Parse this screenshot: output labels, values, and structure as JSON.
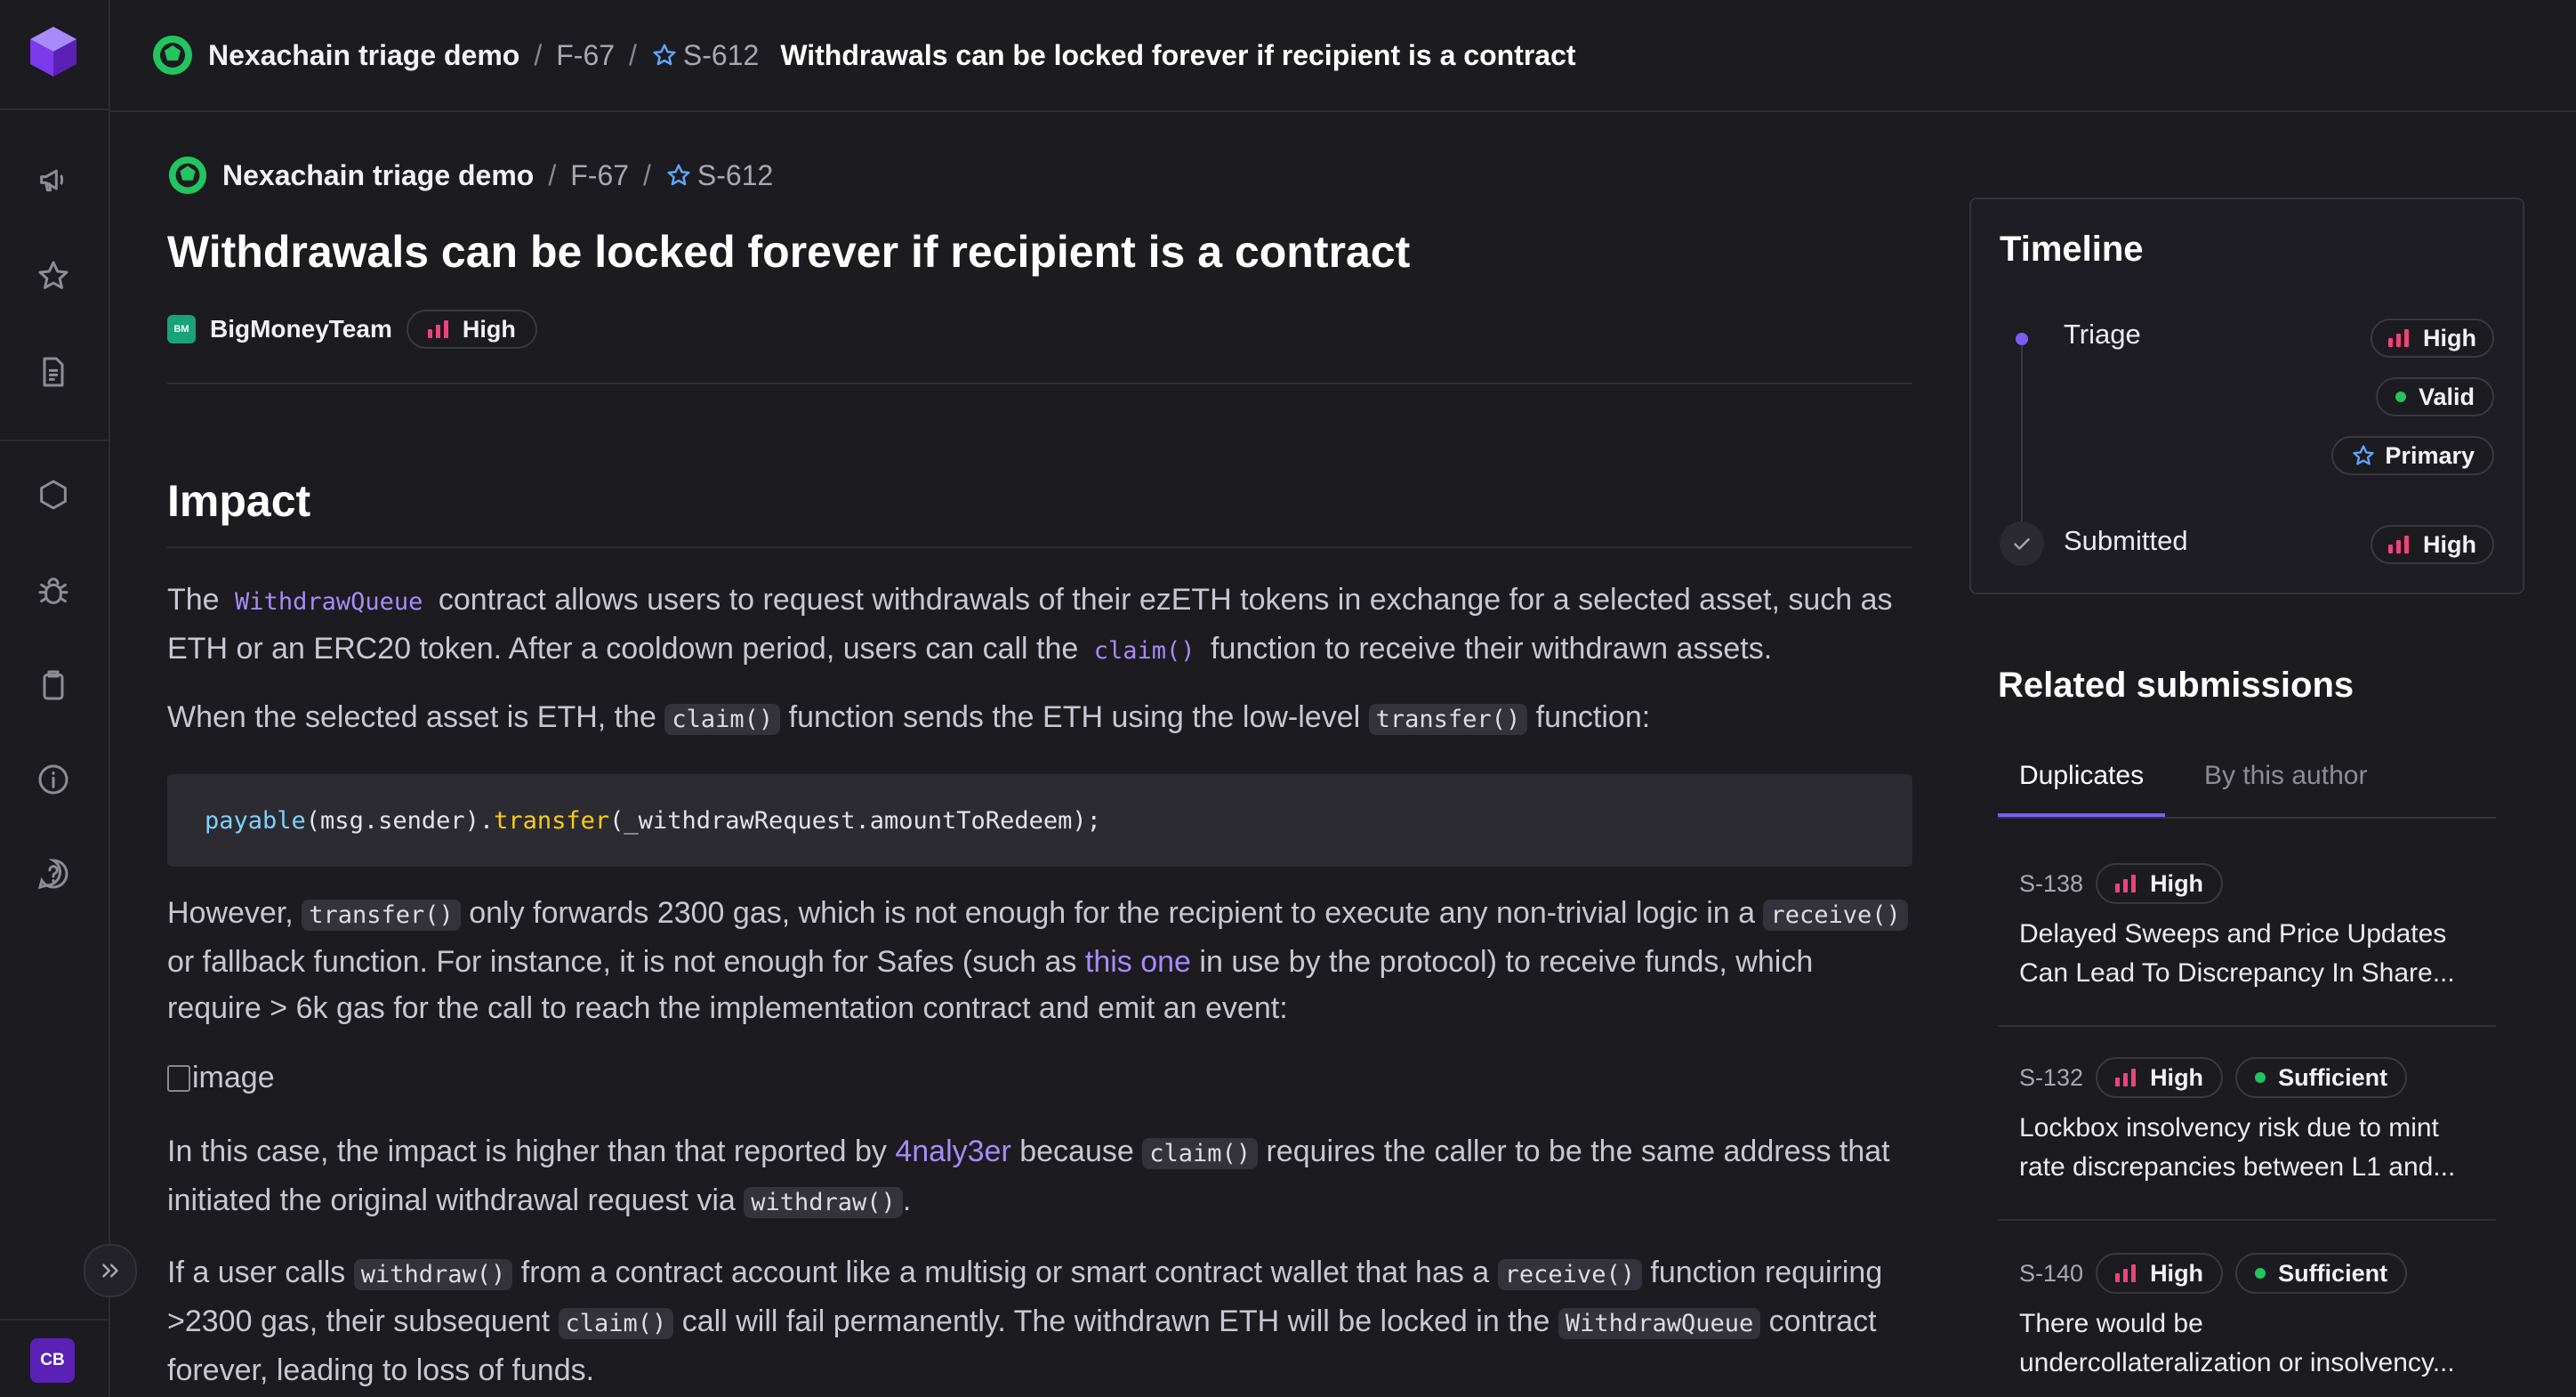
{
  "breadcrumb": {
    "project": "Nexachain triage demo",
    "separator": "/",
    "finding": "F-67",
    "submission": "S-612"
  },
  "topbar": {
    "title": "Withdrawals can be locked forever if recipient is a contract"
  },
  "report": {
    "title": "Withdrawals can be locked forever if recipient is a contract",
    "team_initials": "BM",
    "team": "BigMoneyTeam",
    "severity": "High",
    "impact_heading": "Impact",
    "p1": {
      "a": "The ",
      "code1": "WithdrawQueue",
      "b": " contract allows users to request withdrawals of their ezETH tokens in exchange for a selected asset, such as ETH or an ERC20 token. After a cooldown period, users can call the ",
      "code2": "claim()",
      "c": " function to receive their withdrawn assets."
    },
    "p2": {
      "a": "When the selected asset is ETH, the ",
      "code1": "claim()",
      "b": " function sends the ETH using the low-level ",
      "code2": "transfer()",
      "c": " function:"
    },
    "code_block": {
      "kw": "payable",
      "a": "(msg.sender).",
      "fn": "transfer",
      "b": "(_withdrawRequest.amountToRedeem);"
    },
    "p3": {
      "a": "However, ",
      "code1": "transfer()",
      "b": " only forwards 2300 gas, which is not enough for the recipient to execute any non-trivial logic in a ",
      "code2": "receive()",
      "c": " or fallback function. For instance, it is not enough for Safes (such as ",
      "link": "this one",
      "d": " in use by the protocol) to receive funds, which require > 6k gas for the call to reach the implementation contract and emit an event:"
    },
    "image_alt": "image",
    "p4": {
      "a": "In this case, the impact is higher than that reported by ",
      "link": "4naly3er",
      "b": " because ",
      "code1": "claim()",
      "c": " requires the caller to be the same address that initiated the original withdrawal request via ",
      "code2": "withdraw()",
      "d": "."
    },
    "p5": {
      "a": "If a user calls ",
      "code1": "withdraw()",
      "b": " from a contract account like a multisig or smart contract wallet that has a ",
      "code2": "receive()",
      "c": " function requiring >2300 gas, their subsequent ",
      "code3": "claim()",
      "d": " call will fail permanently. The withdrawn ETH will be locked in the ",
      "code4": "WithdrawQueue",
      "e": " contract forever, leading to loss of funds."
    }
  },
  "timeline": {
    "title": "Timeline",
    "triage_label": "Triage",
    "triage_severity": "High",
    "triage_validity": "Valid",
    "triage_status": "Primary",
    "submitted_label": "Submitted",
    "submitted_severity": "High"
  },
  "related": {
    "title": "Related submissions",
    "tab_duplicates": "Duplicates",
    "tab_author": "By this author",
    "items": [
      {
        "id": "S-138",
        "severity": "High",
        "status": "",
        "title_line1": "Delayed Sweeps and Price Updates",
        "title_line2": "Can Lead To Discrepancy In Share..."
      },
      {
        "id": "S-132",
        "severity": "High",
        "status": "Sufficient",
        "title_line1": "Lockbox insolvency risk due to mint",
        "title_line2": "rate discrepancies between L1 and..."
      },
      {
        "id": "S-140",
        "severity": "High",
        "status": "Sufficient",
        "title_line1": "There would be",
        "title_line2": "undercollateralization or insolvency..."
      }
    ]
  },
  "user": {
    "initials": "CB"
  },
  "colors": {
    "accent": "#7c5cfc",
    "severity_high": "#f0437a",
    "status_green": "#22c55e",
    "link": "#a78bfa"
  }
}
